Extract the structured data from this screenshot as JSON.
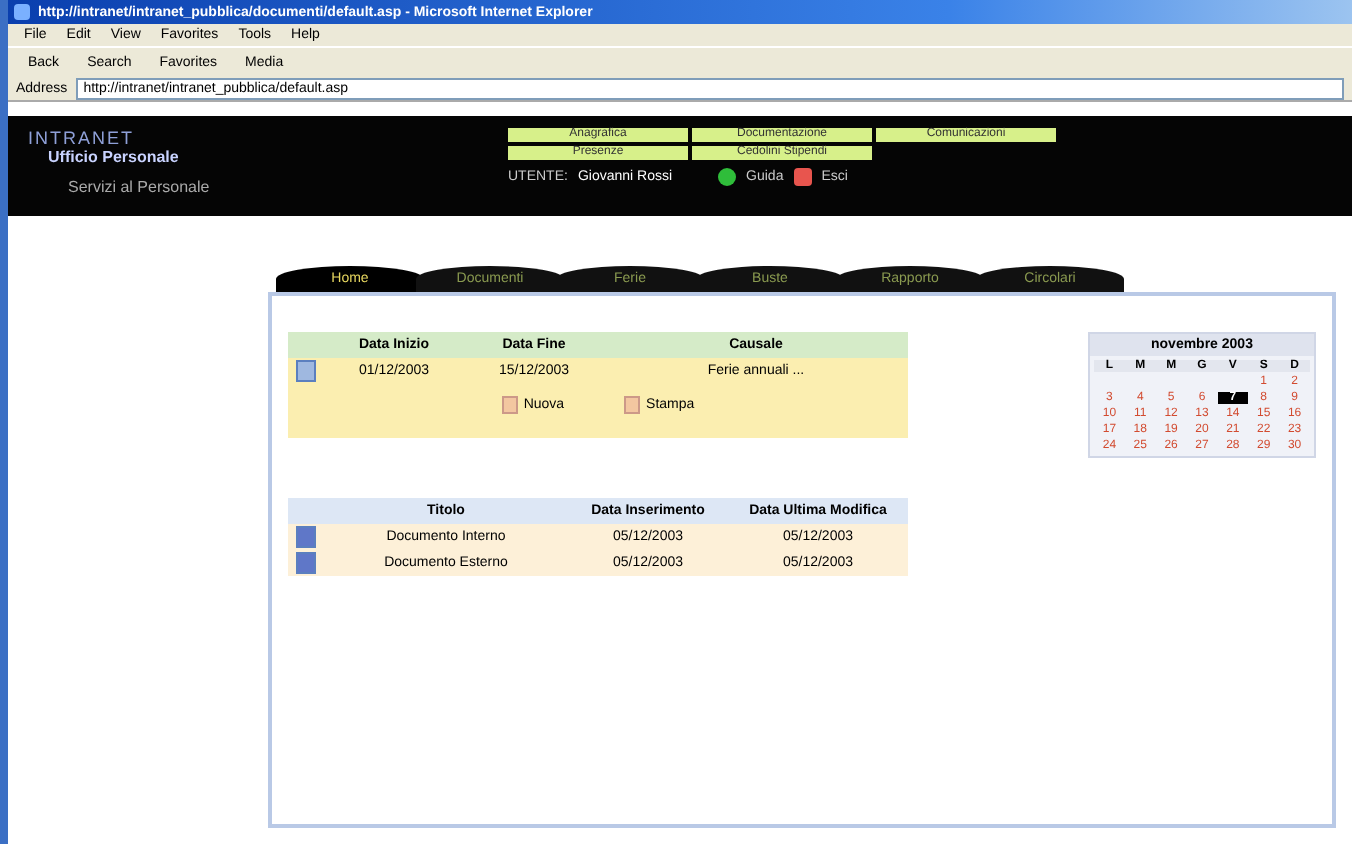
{
  "window": {
    "title": "http://intranet/intranet_pubblica/documenti/default.asp - Microsoft Internet Explorer"
  },
  "menu": [
    "File",
    "Edit",
    "View",
    "Favorites",
    "Tools",
    "Help"
  ],
  "toolbar": [
    "Back",
    "Search",
    "Favorites",
    "Media"
  ],
  "address": {
    "label": "Address",
    "url": "http://intranet/intranet_pubblica/default.asp"
  },
  "header": {
    "logo_title": "INTRANET",
    "logo_subtitle": "Ufficio Personale",
    "section": "Servizi al Personale",
    "links": [
      "Anagrafica",
      "Documentazione",
      "Comunicazioni",
      "Presenze",
      "Cedolini Stipendi"
    ],
    "user_label": "UTENTE:",
    "user_name": "Giovanni Rossi",
    "help": "Guida",
    "exit": "Esci"
  },
  "tabs": [
    {
      "label": "Home",
      "selected": true
    },
    {
      "label": "Documenti",
      "selected": false
    },
    {
      "label": "Ferie",
      "selected": false
    },
    {
      "label": "Buste",
      "selected": false
    },
    {
      "label": "Rapporto",
      "selected": false
    },
    {
      "label": "Circolari",
      "selected": false
    }
  ],
  "requests": {
    "columns": [
      "Data Inizio",
      "Data Fine",
      "Causale"
    ],
    "rows": [
      [
        "01/12/2003",
        "15/12/2003",
        "Ferie annuali ..."
      ]
    ],
    "actions": [
      "Nuova",
      "Stampa"
    ]
  },
  "documents": {
    "columns": [
      "Titolo",
      "Data Inserimento",
      "Data Ultima Modifica"
    ],
    "rows": [
      [
        "Documento Interno",
        "05/12/2003",
        "05/12/2003"
      ],
      [
        "Documento Esterno",
        "05/12/2003",
        "05/12/2003"
      ]
    ]
  },
  "calendar": {
    "title": "novembre 2003",
    "weekdays": [
      "L",
      "M",
      "M",
      "G",
      "V",
      "S",
      "D"
    ],
    "weeks": [
      [
        {
          "label": "1",
          "selected": false
        },
        {
          "label": "2",
          "selected": false
        }
      ],
      [
        {
          "label": "3",
          "selected": false
        },
        {
          "label": "4",
          "selected": false
        },
        {
          "label": "5",
          "selected": false
        },
        {
          "label": "6",
          "selected": false
        },
        {
          "label": "7",
          "selected": true
        },
        {
          "label": "8",
          "selected": false
        },
        {
          "label": "9",
          "selected": false
        }
      ],
      [
        {
          "label": "10",
          "selected": false
        },
        {
          "label": "11",
          "selected": false
        },
        {
          "label": "12",
          "selected": false
        },
        {
          "label": "13",
          "selected": false
        },
        {
          "label": "14",
          "selected": false
        },
        {
          "label": "15",
          "selected": false
        },
        {
          "label": "16",
          "selected": false
        }
      ],
      [
        {
          "label": "17",
          "selected": false
        },
        {
          "label": "18",
          "selected": false
        },
        {
          "label": "19",
          "selected": false
        },
        {
          "label": "20",
          "selected": false
        },
        {
          "label": "21",
          "selected": false
        },
        {
          "label": "22",
          "selected": false
        },
        {
          "label": "23",
          "selected": false
        }
      ],
      [
        {
          "label": "24",
          "selected": false
        },
        {
          "label": "25",
          "selected": false
        },
        {
          "label": "26",
          "selected": false
        },
        {
          "label": "27",
          "selected": false
        },
        {
          "label": "28",
          "selected": false
        },
        {
          "label": "29",
          "selected": false
        },
        {
          "label": "30",
          "selected": false
        }
      ]
    ]
  }
}
